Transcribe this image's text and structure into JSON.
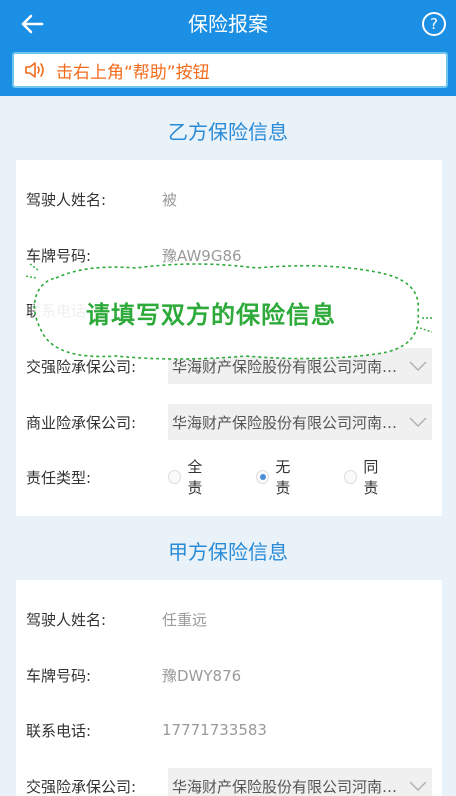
{
  "header": {
    "title": "保险报案",
    "help_label": "?"
  },
  "notice": {
    "text": "击右上角“帮助”按钮",
    "color": "#f26b1d"
  },
  "party_b": {
    "section_title": "乙方保险信息",
    "driver_label": "驾驶人姓名:",
    "driver_value": "被",
    "plate_label": "车牌号码:",
    "plate_value": "豫AW9G86",
    "phone_label": "联系电话",
    "compulsory_label": "交强险承保公司:",
    "compulsory_value": "华海财产保险股份有限公司河南分公司",
    "commercial_label": "商业险承保公司:",
    "commercial_value": "华海财产保险股份有限公司河南分公司",
    "liability_label": "责任类型:",
    "liability_options": [
      "全责",
      "无责",
      "同责"
    ],
    "liability_selected": "无责"
  },
  "party_a": {
    "section_title": "甲方保险信息",
    "driver_label": "驾驶人姓名:",
    "driver_value": "任重远",
    "plate_label": "车牌号码:",
    "plate_value": "豫DWY876",
    "phone_label": "联系电话:",
    "phone_value": "17771733583",
    "compulsory_label": "交强险承保公司:",
    "compulsory_value": "华海财产保险股份有限公司河南分公司"
  },
  "overlay": {
    "text": "请填写双方的保险信息"
  },
  "colors": {
    "header": "#1a8fe3",
    "section_title": "#2a8bd6",
    "overlay_text": "#2eaa3a"
  }
}
